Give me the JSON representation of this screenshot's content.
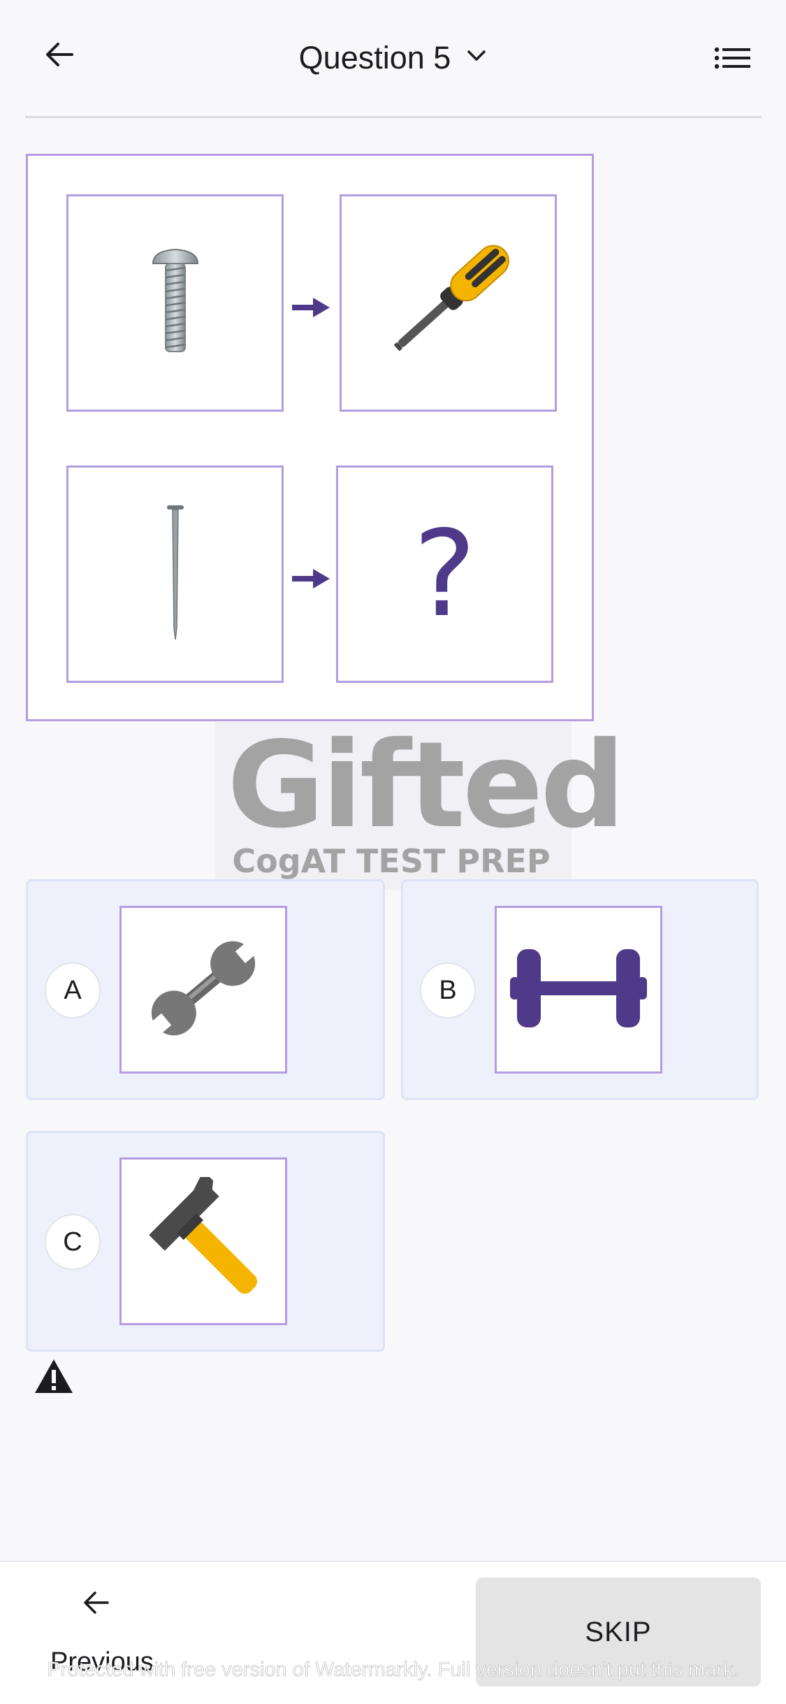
{
  "header": {
    "title": "Question 5",
    "back_icon": "arrow-left-icon",
    "dropdown_icon": "chevron-down-icon",
    "menu_icon": "list-icon"
  },
  "question": {
    "pairs": [
      {
        "left_icon": "screw-icon",
        "arrow_icon": "arrow-right-icon",
        "right_icon": "screwdriver-icon"
      },
      {
        "left_icon": "nail-icon",
        "arrow_icon": "arrow-right-icon",
        "right_label": "?"
      }
    ],
    "border_color": "#b39ce0",
    "accent_color": "#4f3a8a"
  },
  "watermark": {
    "brand": "Gifted",
    "subtitle": "CogAT TEST PREP"
  },
  "options": [
    {
      "letter": "A",
      "icon": "wrench-icon"
    },
    {
      "letter": "B",
      "icon": "dumbbell-icon"
    },
    {
      "letter": "C",
      "icon": "hammer-icon"
    }
  ],
  "report_icon": "warning-icon",
  "footer": {
    "previous_label": "Previous",
    "skip_label": "SKIP",
    "watermark_text": "Protected with free version of Watermarkly. Full version doesn't put this mark."
  }
}
